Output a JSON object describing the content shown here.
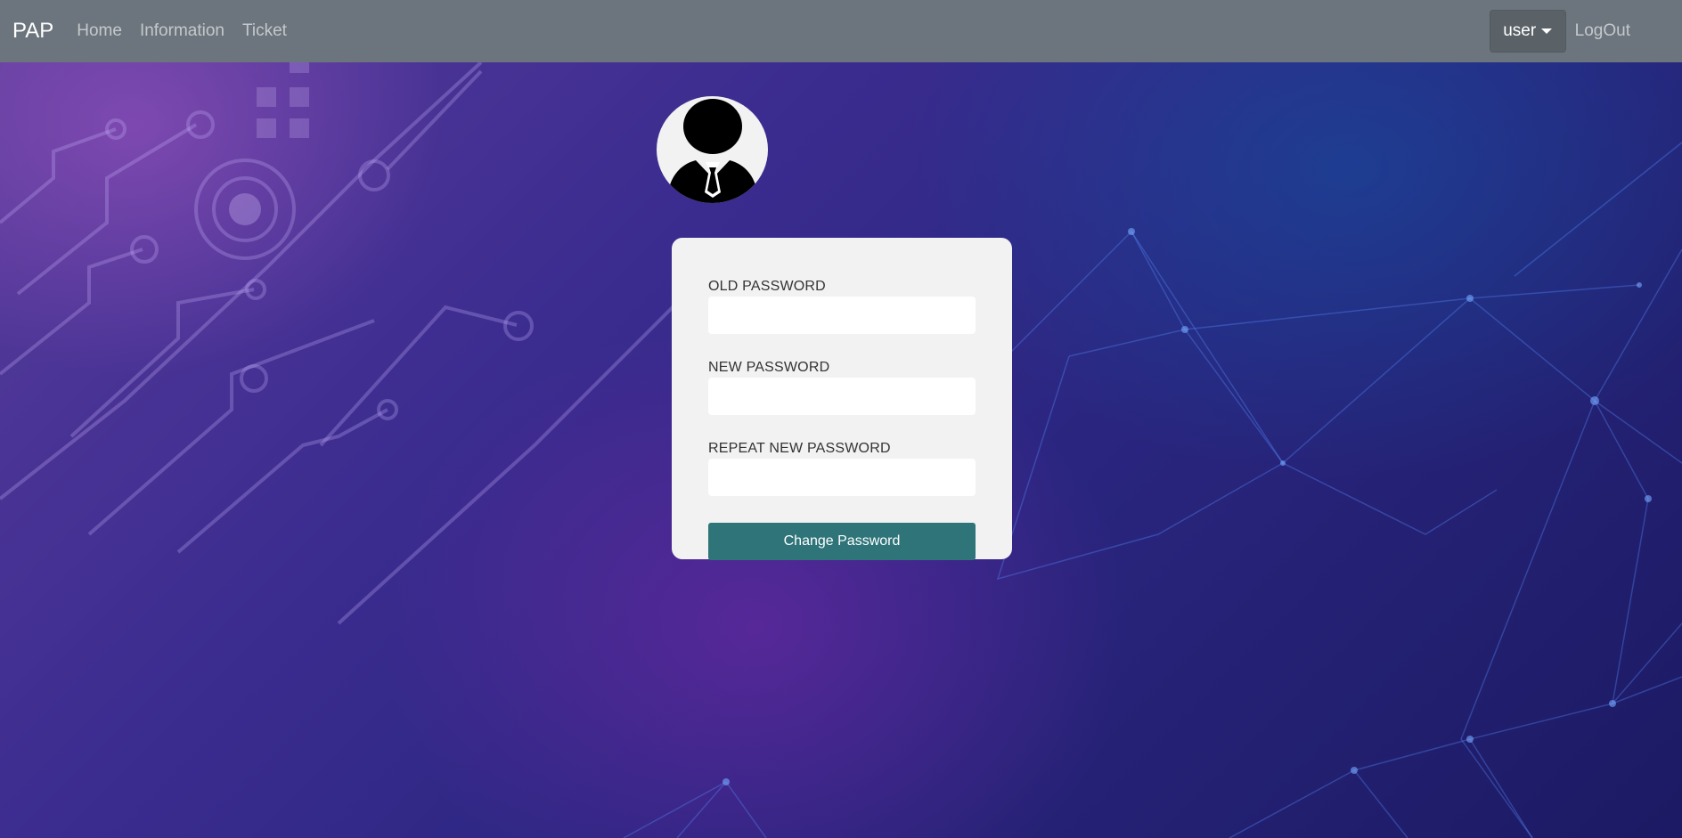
{
  "navbar": {
    "brand": "PAP",
    "links": [
      "Home",
      "Information",
      "Ticket"
    ],
    "user_menu_label": "user",
    "logout_label": "LogOut",
    "background_color": "#6c757d"
  },
  "avatar": {
    "icon": "user-silhouette-icon"
  },
  "form": {
    "old_password_label": "OLD PASSWORD",
    "old_password_value": "",
    "new_password_label": "NEW PASSWORD",
    "new_password_value": "",
    "repeat_password_label": "REPEAT NEW PASSWORD",
    "repeat_password_value": "",
    "submit_label": "Change Password",
    "submit_color": "#2e7479"
  }
}
